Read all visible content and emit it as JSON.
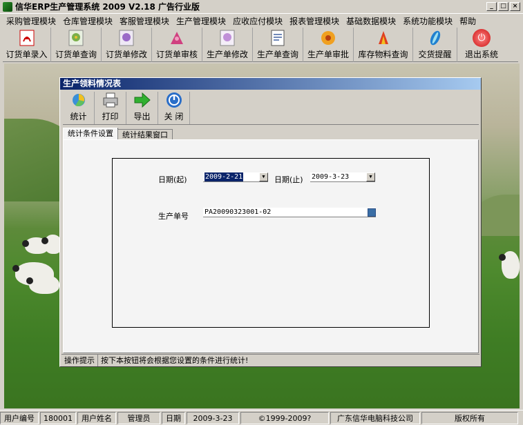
{
  "window": {
    "title": "信华ERP生产管理系统  2009 V2.18 广告行业版",
    "controls": [
      "_",
      "□",
      "×"
    ]
  },
  "menubar": {
    "items": [
      "采购管理模块",
      "仓库管理模块",
      "客服管理模块",
      "生产管理模块",
      "应收应付模块",
      "报表管理模块",
      "基础数据模块",
      "系统功能模块",
      "帮助"
    ]
  },
  "toolbar": {
    "buttons": [
      {
        "label": "订货单录入",
        "icon": "pdf-icon"
      },
      {
        "label": "订货单查询",
        "icon": "flower-icon"
      },
      {
        "label": "订货单修改",
        "icon": "purple-flower-icon"
      },
      {
        "label": "订货单审核",
        "icon": "pink-flower-icon"
      },
      {
        "label": "生产单修改",
        "icon": "lilac-flower-icon"
      },
      {
        "label": "生产单查询",
        "icon": "document-icon"
      },
      {
        "label": "生产单审批",
        "icon": "sunflower-icon"
      },
      {
        "label": "库存物料查询",
        "icon": "red-flower-icon"
      },
      {
        "label": "交货提醒",
        "icon": "feather-icon"
      },
      {
        "label": "退出系统",
        "icon": "exit-icon"
      }
    ]
  },
  "dialog": {
    "title": "生产领料情况表",
    "toolbar": {
      "buttons": [
        {
          "label": "统计",
          "icon": "chart-icon"
        },
        {
          "label": "打印",
          "icon": "printer-icon"
        },
        {
          "label": "导出",
          "icon": "arrow-right-icon"
        },
        {
          "label": "关 闭",
          "icon": "power-icon"
        }
      ]
    },
    "tabs": [
      "统计条件设置",
      "统计结果窗口"
    ],
    "form": {
      "date_from_label": "日期(起)",
      "date_from_value": "2009-2-21",
      "date_to_label": "日期(止)",
      "date_to_value": "2009-3-23",
      "order_label": "生产单号",
      "order_value": "PA20090323001-02"
    },
    "hint": {
      "label": "操作提示",
      "text": "按下本按钮将会根据您设置的条件进行统计!"
    }
  },
  "statusbar": {
    "user_id_label": "用户编号",
    "user_id_value": "180001",
    "user_name_label": "用户姓名",
    "user_name_value": "管理员",
    "date_label": "日期",
    "date_value": "2009-3-23",
    "copyright": "©1999-2009?",
    "company": "广东信华电脑科技公司",
    "rights": "版权所有"
  },
  "colors": {
    "title_gradient_start": "#0a246a",
    "title_gradient_end": "#a6caf0",
    "window_face": "#d4d0c8"
  }
}
